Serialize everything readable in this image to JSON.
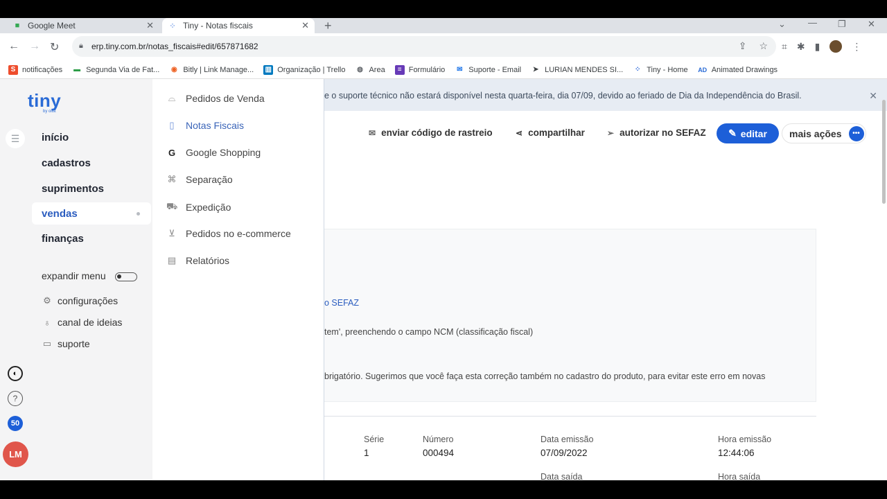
{
  "browser": {
    "tabs": [
      {
        "title": "Google Meet",
        "icon": "meet-icon",
        "active": false
      },
      {
        "title": "Tiny - Notas fiscais",
        "icon": "tiny-icon",
        "active": true
      }
    ],
    "url": "erp.tiny.com.br/notas_fiscais#edit/657871682",
    "bookmarks": [
      {
        "label": "notificações",
        "icon": "shopee-icon",
        "color": "#ee4d2d"
      },
      {
        "label": "Segunda Via de Fat...",
        "icon": "dash-icon",
        "color": "#2e9e48"
      },
      {
        "label": "Bitly | Link Manage...",
        "icon": "bitly-icon",
        "color": "#ee6123"
      },
      {
        "label": "Organização | Trello",
        "icon": "trello-icon",
        "color": "#0079bf"
      },
      {
        "label": "Area",
        "icon": "globe-icon",
        "color": "#5f6368"
      },
      {
        "label": "Formulário",
        "icon": "form-icon",
        "color": "#673ab7"
      },
      {
        "label": "Suporte - Email",
        "icon": "mail-icon",
        "color": "#1a73e8"
      },
      {
        "label": "LURIAN MENDES SI...",
        "icon": "arrow-icon",
        "color": "#3c4043"
      },
      {
        "label": "Tiny - Home",
        "icon": "tiny-icon",
        "color": "#1d5fd8"
      },
      {
        "label": "Animated Drawings",
        "icon": "ad-icon",
        "color": "#2a6bd6"
      }
    ]
  },
  "sidebar": {
    "logo": "tiny",
    "logo_sub": "by olist",
    "items": [
      "início",
      "cadastros",
      "suprimentos",
      "vendas",
      "finanças"
    ],
    "active": "vendas",
    "expand_label": "expandir menu",
    "links": [
      "configurações",
      "canal de ideias",
      "suporte"
    ],
    "badge_count": "50",
    "user_initials": "LM",
    "user_color": "#e0564b"
  },
  "submenu": {
    "items": [
      {
        "label": "Pedidos de Venda",
        "icon": "inbox-icon"
      },
      {
        "label": "Notas Fiscais",
        "icon": "document-icon",
        "selected": true
      },
      {
        "label": "Google Shopping",
        "icon": "google-icon"
      },
      {
        "label": "Separação",
        "icon": "boxes-icon"
      },
      {
        "label": "Expedição",
        "icon": "truck-icon"
      },
      {
        "label": "Pedidos no e-commerce",
        "icon": "cart-icon"
      },
      {
        "label": "Relatórios",
        "icon": "report-icon"
      }
    ]
  },
  "main": {
    "notice": "e o suporte técnico não estará disponível nesta quarta-feira, dia 07/09, devido ao feriado de Dia da Independência do Brasil.",
    "actions": {
      "tracking": "enviar código de rastreio",
      "share": "compartilhar",
      "authorize": "autorizar no SEFAZ",
      "edit": "editar",
      "more": "mais ações"
    },
    "errors": {
      "line1": "o SEFAZ",
      "line2": "tem', preenchendo o campo NCM (classificação fiscal)",
      "line3": "brigatório. Sugerimos que você faça esta correção também no cadastro do produto, para evitar este erro em novas"
    },
    "fields": {
      "serie_label": "Série",
      "serie": "1",
      "numero_label": "Número",
      "numero": "000494",
      "data_emissao_label": "Data emissão",
      "data_emissao": "07/09/2022",
      "hora_emissao_label": "Hora emissão",
      "hora_emissao": "12:44:06",
      "data_saida_label": "Data saída",
      "hora_saida_label": "Hora saída"
    },
    "accent": "#1d5fd8"
  }
}
